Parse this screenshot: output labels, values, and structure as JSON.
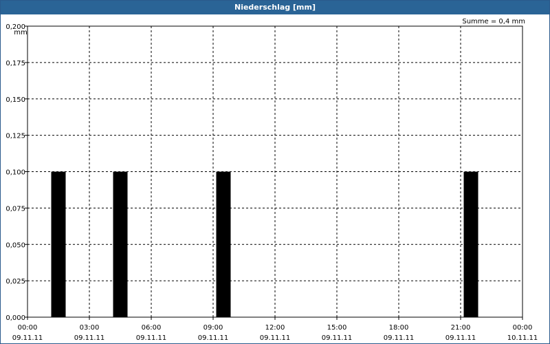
{
  "window": {
    "title": "Niederschlag [mm]"
  },
  "summary": {
    "text": "Summe = 0,4 mm"
  },
  "colors": {
    "titlebar": "#2a6496",
    "bar": "#000000",
    "grid": "#000000"
  },
  "chart_data": {
    "type": "bar",
    "title": "Niederschlag [mm]",
    "ylabel": "mm",
    "xlabel": "",
    "ylim": [
      0,
      0.2
    ],
    "yticks": [
      "0,000",
      "0,025",
      "0,050",
      "0,075",
      "0,100",
      "0,125",
      "0,150",
      "0,175",
      "0,200"
    ],
    "xticks": [
      {
        "time": "00:00",
        "date": "09.11.11"
      },
      {
        "time": "03:00",
        "date": "09.11.11"
      },
      {
        "time": "06:00",
        "date": "09.11.11"
      },
      {
        "time": "09:00",
        "date": "09.11.11"
      },
      {
        "time": "12:00",
        "date": "09.11.11"
      },
      {
        "time": "15:00",
        "date": "09.11.11"
      },
      {
        "time": "18:00",
        "date": "09.11.11"
      },
      {
        "time": "21:00",
        "date": "09.11.11"
      },
      {
        "time": "00:00",
        "date": "10.11.11"
      }
    ],
    "bars": [
      {
        "start": "01:00",
        "end": "02:00",
        "value": 0.1
      },
      {
        "start": "04:00",
        "end": "05:00",
        "value": 0.1
      },
      {
        "start": "09:00",
        "end": "10:00",
        "value": 0.1
      },
      {
        "start": "21:00",
        "end": "22:00",
        "value": 0.1
      }
    ],
    "grid": true,
    "summary": "Summe = 0,4 mm"
  }
}
